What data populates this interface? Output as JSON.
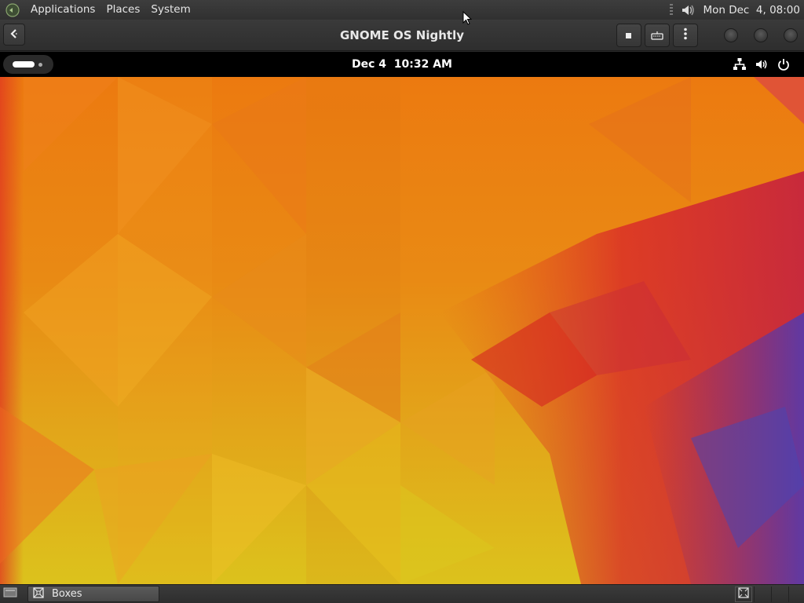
{
  "top_panel": {
    "menus": [
      "Applications",
      "Places",
      "System"
    ],
    "clock": "Mon Dec  4, 08:00"
  },
  "window": {
    "title": "GNOME OS Nightly",
    "icons": {
      "back": "back-arrow-icon",
      "stop": "stop-icon",
      "keyboard": "keyboard-icon",
      "menu": "kebab-menu-icon"
    }
  },
  "guest_bar": {
    "clock": "Dec 4  10:32 AM",
    "icons": [
      "network-icon",
      "volume-icon",
      "power-icon"
    ]
  },
  "taskbar": {
    "tasks": [
      {
        "label": "Boxes",
        "icon": "boxes-icon"
      }
    ]
  },
  "colors": {
    "wallpaper_top": "#ec7a10",
    "wallpaper_bottom": "#dcc21c",
    "wallpaper_red": "#d8232a",
    "wallpaper_purple": "#6a3aa0"
  }
}
